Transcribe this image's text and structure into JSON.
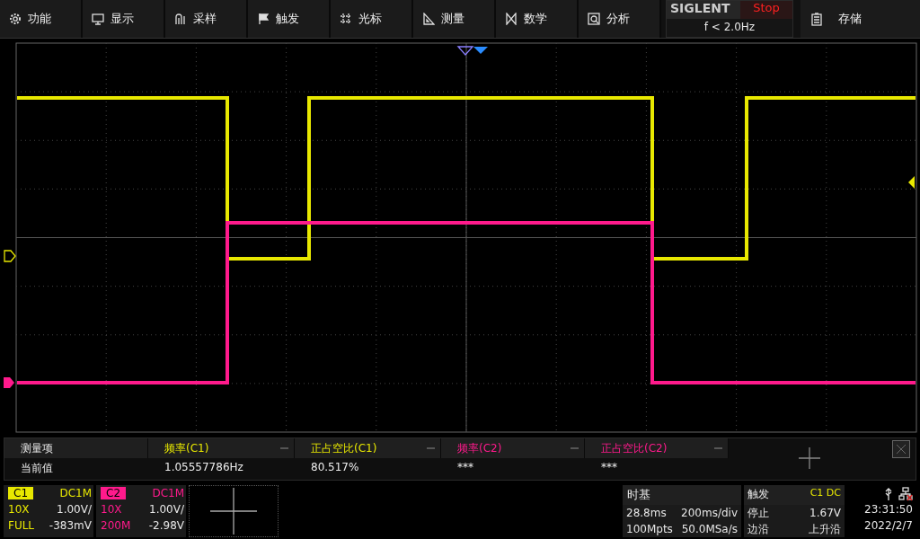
{
  "menu": [
    {
      "label": "功能"
    },
    {
      "label": "显示"
    },
    {
      "label": "采样"
    },
    {
      "label": "触发"
    },
    {
      "label": "光标"
    },
    {
      "label": "测量"
    },
    {
      "label": "数学"
    },
    {
      "label": "分析"
    }
  ],
  "status": {
    "brand": "SIGLENT",
    "state": "Stop",
    "frequency": "f < 2.0Hz"
  },
  "save": {
    "label": "存储"
  },
  "measurements": {
    "header_label": "测量项",
    "row_label": "当前值",
    "columns": [
      {
        "name": "频率(C1)",
        "value": "1.05557786Hz",
        "color": "#e8e800"
      },
      {
        "name": "正占空比(C1)",
        "value": "80.517%",
        "color": "#e8e800"
      },
      {
        "name": "频率(C2)",
        "value": "***",
        "color": "#ff1a8c"
      },
      {
        "name": "正占空比(C2)",
        "value": "***",
        "color": "#ff1a8c"
      }
    ]
  },
  "channels": [
    {
      "label": "C1",
      "coupling": "DC1M",
      "probe": "10X",
      "scale": "1.00V/",
      "bandwidth": "FULL",
      "offset": "-383mV",
      "color": "#e8e800"
    },
    {
      "label": "C2",
      "coupling": "DC1M",
      "probe": "10X",
      "scale": "1.00V/",
      "bandwidth": "200M",
      "offset": "-2.98V",
      "color": "#ff1a8c"
    }
  ],
  "timebase": {
    "title": "时基",
    "delay": "28.8ms",
    "scale": "200ms/div",
    "memory": "100Mpts",
    "sample_rate": "50.0MSa/s"
  },
  "trigger": {
    "title": "触发",
    "source": "C1 DC",
    "mode": "停止",
    "level": "1.67V",
    "type": "边沿",
    "slope": "上升沿"
  },
  "clock": {
    "time": "23:31:50",
    "date": "2022/2/7"
  }
}
